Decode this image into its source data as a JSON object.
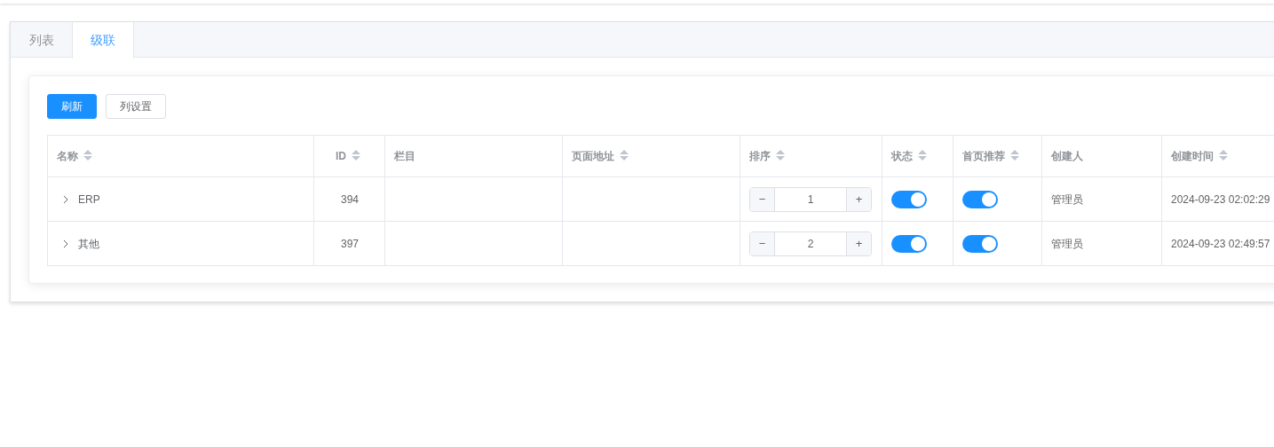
{
  "tabs": [
    {
      "label": "列表",
      "selected": false
    },
    {
      "label": "级联",
      "selected": true
    }
  ],
  "toolbar": [
    {
      "label": "刷新",
      "kind": "primary"
    },
    {
      "label": "列设置",
      "kind": "default"
    }
  ],
  "table": {
    "columns": [
      {
        "label": "名称",
        "sortable": true
      },
      {
        "label": "ID",
        "sortable": true
      },
      {
        "label": "栏目",
        "sortable": false
      },
      {
        "label": "页面地址",
        "sortable": true
      },
      {
        "label": "排序",
        "sortable": true
      },
      {
        "label": "状态",
        "sortable": true
      },
      {
        "label": "首页推荐",
        "sortable": true
      },
      {
        "label": "创建人",
        "sortable": false
      },
      {
        "label": "创建时间",
        "sortable": true
      }
    ],
    "rows": [
      {
        "name": "ERP",
        "expanded": false,
        "id": "394",
        "sort": {
          "minus": "−",
          "value": "1",
          "plus": "+"
        },
        "status_on": true,
        "featured_on": true,
        "creator": "管理员",
        "created": "2024-09-23 02:02:29"
      },
      {
        "name": "其他",
        "expanded": false,
        "id": "397",
        "sort": {
          "minus": "−",
          "value": "2",
          "plus": "+"
        },
        "status_on": true,
        "featured_on": true,
        "creator": "管理员",
        "created": "2024-09-23 02:49:57"
      }
    ]
  }
}
